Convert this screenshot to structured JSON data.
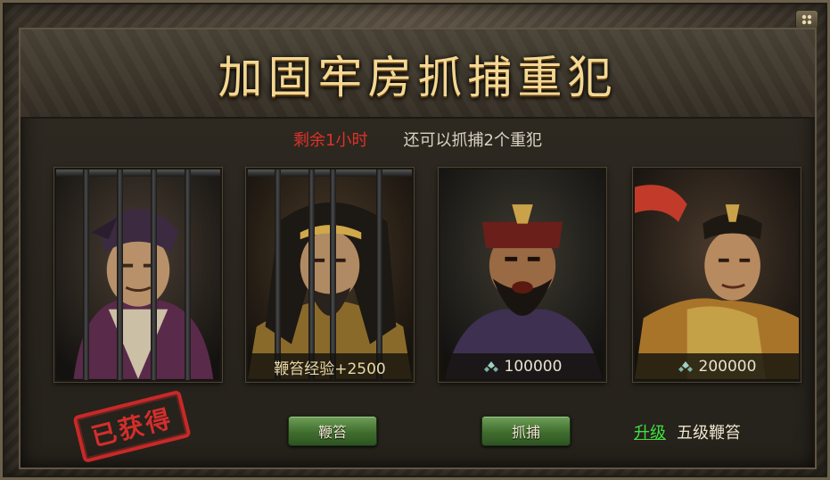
{
  "window": {
    "title": "加固牢房抓捕重犯",
    "close_icon": "grid-icon"
  },
  "status": {
    "time_left": "剩余1小时",
    "can_catch": "还可以抓捕2个重犯"
  },
  "cards": [
    {
      "id": "prisoner-1",
      "caged": true,
      "stamp": "已获得"
    },
    {
      "id": "prisoner-2",
      "caged": true,
      "caption": "鞭笞经验+2500",
      "button": "鞭笞"
    },
    {
      "id": "general-1",
      "caged": false,
      "cost": "100000",
      "cost_icon": "silver-ingot-icon",
      "button": "抓捕"
    },
    {
      "id": "general-2",
      "caged": false,
      "cost": "200000",
      "cost_icon": "silver-ingot-icon",
      "upgrade_link": "升级",
      "level_text": "五级鞭笞"
    }
  ],
  "colors": {
    "title": "#f3d792",
    "time_left": "#e0312a",
    "button_green": "#3f6e2e",
    "stamp_red": "#d62a2a",
    "upgrade_link": "#40e040"
  }
}
